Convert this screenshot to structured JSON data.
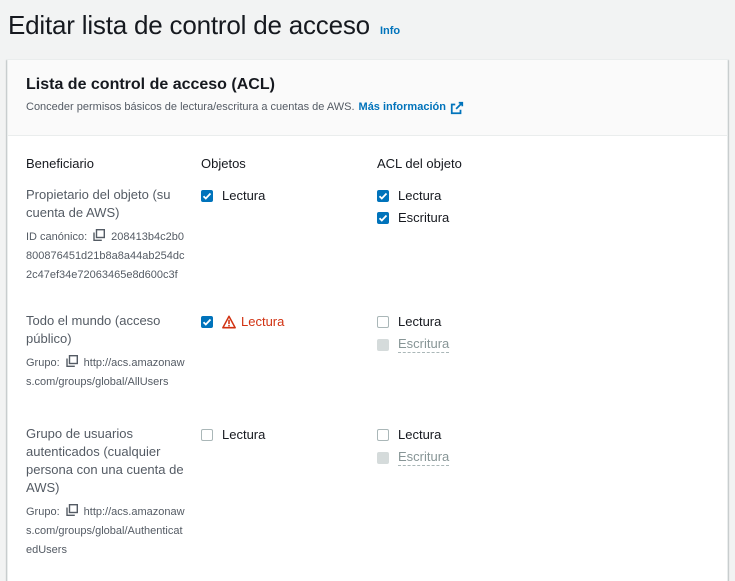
{
  "header": {
    "title": "Editar lista de control de acceso",
    "info": "Info"
  },
  "panel": {
    "title": "Lista de control de acceso (ACL)",
    "description": "Conceder permisos básicos de lectura/escritura a cuentas de AWS.",
    "learn_more": "Más información"
  },
  "columns": {
    "grantee": "Beneficiario",
    "objects": "Objetos",
    "object_acl": "ACL del objeto"
  },
  "rows": [
    {
      "name": "Propietario del objeto (su cuenta de AWS)",
      "meta_label": "ID canónico:",
      "meta_value": "208413b4c2b0800876451d21b8a8a44ab254dc2c47ef34e72063465e8d600c3f",
      "objects_read": "Lectura",
      "acl_read": "Lectura",
      "acl_write": "Escritura"
    },
    {
      "name": "Todo el mundo (acceso público)",
      "meta_label": "Grupo:",
      "meta_value": "http://acs.amazonaws.com/groups/global/AllUsers",
      "objects_read": "Lectura",
      "acl_read": "Lectura",
      "acl_write": "Escritura"
    },
    {
      "name": "Grupo de usuarios autenticados (cualquier persona con una cuenta de AWS)",
      "meta_label": "Grupo:",
      "meta_value": "http://acs.amazonaws.com/groups/global/AuthenticatedUsers",
      "objects_read": "Lectura",
      "acl_read": "Lectura",
      "acl_write": "Escritura"
    }
  ],
  "colors": {
    "accent": "#0073bb",
    "warning": "#d13212"
  },
  "icons": {
    "copy": "copy-icon",
    "external": "external-link-icon",
    "warning": "warning-icon",
    "check": "check-icon"
  }
}
